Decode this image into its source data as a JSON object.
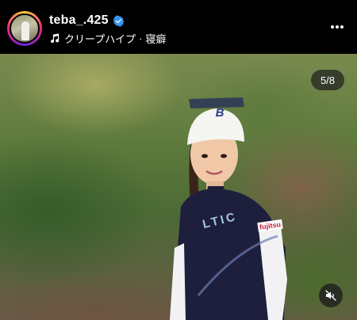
{
  "post_header": {
    "username": "teba_.425",
    "verified": true,
    "audio_track": "クリープハイプ",
    "audio_separator": "·",
    "audio_title": "寝癖"
  },
  "carousel": {
    "counter": "5/8"
  },
  "cap": {
    "logo_letter": "B"
  },
  "shirt": {
    "text": "LTIC",
    "sponsor": "fujitsu"
  },
  "colors": {
    "verified_blue": "#3897f0",
    "header_bg": "#000000"
  }
}
